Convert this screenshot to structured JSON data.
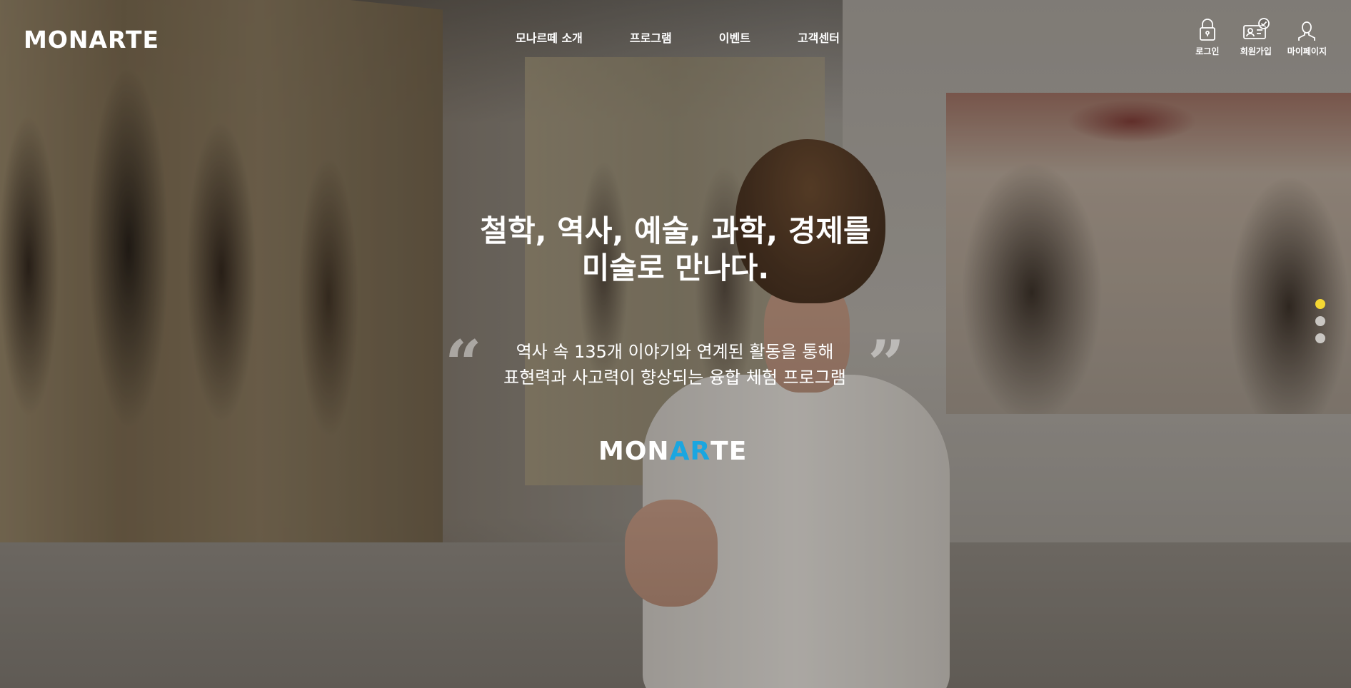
{
  "brand": {
    "logo_text": "MONARTE",
    "logo_parts": [
      "MON",
      "A",
      "R",
      "TE"
    ],
    "accent_color": "#1aa6e0"
  },
  "nav": {
    "items": [
      {
        "label": "모나르떼 소개"
      },
      {
        "label": "프로그램"
      },
      {
        "label": "이벤트"
      },
      {
        "label": "고객센터"
      }
    ]
  },
  "utility": {
    "login": {
      "label": "로그인",
      "icon": "lock-icon"
    },
    "signup": {
      "label": "회원가입",
      "icon": "user-check-icon"
    },
    "mypage": {
      "label": "마이페이지",
      "icon": "person-icon"
    }
  },
  "hero": {
    "headline_line1": "철학, 역사, 예술, 과학, 경제를",
    "headline_line2": "미술로 만나다.",
    "desc_line1": "역사 속 135개 이야기와 연계된 활동을 통해",
    "desc_line2": "표현력과 사고력이 향상되는 융합 체험 프로그램",
    "quote_open": "“",
    "quote_close": "”"
  },
  "pager": {
    "active_index": 0,
    "count": 3,
    "active_color": "#f4d733",
    "inactive_color": "#c9c6c2"
  }
}
